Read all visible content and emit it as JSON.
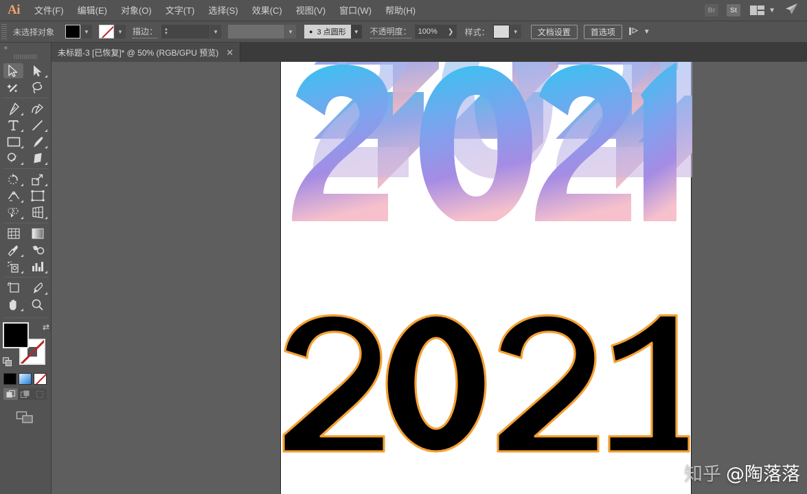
{
  "app": {
    "name": "Adobe Illustrator",
    "logo_text": "Ai",
    "accent_color": "#f29f6a",
    "chrome_color": "#535353"
  },
  "menubar": {
    "items": [
      {
        "label": "文件(F)",
        "name": "menu-file"
      },
      {
        "label": "编辑(E)",
        "name": "menu-edit"
      },
      {
        "label": "对象(O)",
        "name": "menu-object"
      },
      {
        "label": "文字(T)",
        "name": "menu-type"
      },
      {
        "label": "选择(S)",
        "name": "menu-select"
      },
      {
        "label": "效果(C)",
        "name": "menu-effect"
      },
      {
        "label": "视图(V)",
        "name": "menu-view"
      },
      {
        "label": "窗口(W)",
        "name": "menu-window"
      },
      {
        "label": "帮助(H)",
        "name": "menu-help"
      }
    ],
    "bridge_label": "Br",
    "stock_label": "St",
    "arrange_icon": "arrange-documents-icon",
    "chevron_icon": "chevron-down-icon",
    "rocket_icon": "rocket-icon"
  },
  "controlbar": {
    "selection_status": "未选择对象",
    "fill_label": "fill-swatch",
    "fill_color": "#000000",
    "stroke_swatch_label": "stroke-swatch-none",
    "stroke_label": "描边：",
    "stroke_weight_value": "",
    "stroke_weight_placeholder": "",
    "stroke_style_value": "",
    "stroke_profile": "3 点圆形",
    "opacity_label": "不透明度：",
    "opacity_value": "100%",
    "style_label": "样式：",
    "style_swatch_color": "#d9d9d9",
    "document_setup_button": "文档设置",
    "preferences_button": "首选项",
    "align_icon": "align-objects-icon"
  },
  "tabbar": {
    "document_tab": "未标题-3 [已恢复]* @ 50% (RGB/GPU 预览)",
    "close_glyph": "✕"
  },
  "toolbar": {
    "collapse_glyph": "«",
    "tools": [
      {
        "name": "selection-tool",
        "label": "选择工具",
        "active": true,
        "corner": false
      },
      {
        "name": "direct-selection-tool",
        "label": "直接选择工具",
        "active": false,
        "corner": true
      },
      {
        "name": "magic-wand-tool",
        "label": "魔棒工具",
        "active": false,
        "corner": false
      },
      {
        "name": "lasso-tool",
        "label": "套索工具",
        "active": false,
        "corner": false
      },
      {
        "name": "pen-tool",
        "label": "钢笔工具",
        "active": false,
        "corner": true
      },
      {
        "name": "curvature-tool",
        "label": "曲率工具",
        "active": false,
        "corner": false
      },
      {
        "name": "type-tool",
        "label": "文字工具",
        "active": false,
        "corner": true
      },
      {
        "name": "line-segment-tool",
        "label": "直线段工具",
        "active": false,
        "corner": true
      },
      {
        "name": "rectangle-tool",
        "label": "矩形工具",
        "active": false,
        "corner": true
      },
      {
        "name": "paintbrush-tool",
        "label": "画笔工具",
        "active": false,
        "corner": true
      },
      {
        "name": "shaper-pencil-tool",
        "label": "Shaper 工具",
        "active": false,
        "corner": true
      },
      {
        "name": "eraser-tool",
        "label": "橡皮擦工具",
        "active": false,
        "corner": true
      },
      {
        "name": "rotate-tool",
        "label": "旋转工具",
        "active": false,
        "corner": true
      },
      {
        "name": "scale-tool",
        "label": "比例缩放工具",
        "active": false,
        "corner": true
      },
      {
        "name": "width-tool",
        "label": "宽度工具",
        "active": false,
        "corner": true
      },
      {
        "name": "free-transform-tool",
        "label": "自由变换工具",
        "active": false,
        "corner": false
      },
      {
        "name": "shape-builder-tool",
        "label": "形状生成器工具",
        "active": false,
        "corner": true
      },
      {
        "name": "perspective-grid-tool",
        "label": "透视网格工具",
        "active": false,
        "corner": true
      },
      {
        "name": "mesh-tool",
        "label": "网格工具",
        "active": false,
        "corner": false
      },
      {
        "name": "gradient-tool",
        "label": "渐变工具",
        "active": false,
        "corner": false
      },
      {
        "name": "eyedropper-tool",
        "label": "吸管工具",
        "active": false,
        "corner": true
      },
      {
        "name": "blend-tool",
        "label": "混合工具",
        "active": false,
        "corner": false
      },
      {
        "name": "symbol-sprayer-tool",
        "label": "符号喷枪工具",
        "active": false,
        "corner": true
      },
      {
        "name": "column-graph-tool",
        "label": "柱形图工具",
        "active": false,
        "corner": true
      },
      {
        "name": "artboard-tool",
        "label": "画板工具",
        "active": false,
        "corner": false
      },
      {
        "name": "slice-tool",
        "label": "切片工具",
        "active": false,
        "corner": true
      },
      {
        "name": "hand-tool",
        "label": "抓手工具",
        "active": false,
        "corner": true
      },
      {
        "name": "zoom-tool",
        "label": "缩放工具",
        "active": false,
        "corner": false
      }
    ],
    "fill_color": "#000000",
    "stroke_color": "none",
    "swap_icon": "swap-fill-stroke-icon",
    "default_icon": "default-fill-stroke-icon",
    "color_mode_buttons": [
      {
        "name": "color-button",
        "label": "颜色"
      },
      {
        "name": "gradient-button",
        "label": "渐变"
      },
      {
        "name": "none-button",
        "label": "无"
      }
    ],
    "draw_modes": [
      {
        "name": "draw-normal-mode",
        "label": "正常绘图",
        "on": true
      },
      {
        "name": "draw-behind-mode",
        "label": "背面绘图",
        "on": false
      },
      {
        "name": "draw-inside-mode",
        "label": "内部绘图",
        "on": false
      }
    ],
    "screen_mode": {
      "name": "change-screen-mode-button",
      "label": "更改屏幕模式"
    }
  },
  "canvas": {
    "artboard_background": "#ffffff",
    "workspace_background": "#5e5e5e",
    "artwork_3d": {
      "name": "extruded-2021-artwork",
      "text": "2021",
      "style": "3d-extrude",
      "gradient_top": "#3fc0ee",
      "gradient_mid": "#8c9bf0",
      "gradient_bottom": "#f7c0ca",
      "cropped_at_top": true
    },
    "artwork_flat": {
      "name": "flat-2021-artwork",
      "text": "2021",
      "fill_color": "#000000",
      "stroke_color": "#f5a033",
      "stroke_width": 3
    }
  },
  "watermark": {
    "platform": "知乎",
    "user": "@陶落落"
  }
}
